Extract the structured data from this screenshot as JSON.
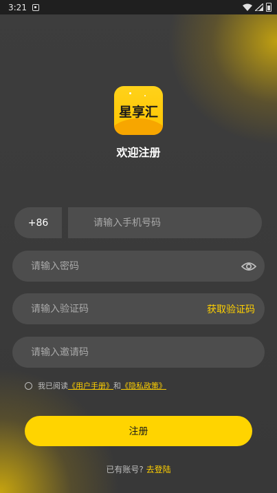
{
  "status_bar": {
    "time": "3:21"
  },
  "app": {
    "logo_text": "星享汇",
    "title": "欢迎注册"
  },
  "form": {
    "country_code": "+86",
    "phone_placeholder": "请输入手机号码",
    "password_placeholder": "请输入密码",
    "code_placeholder": "请输入验证码",
    "get_code_label": "获取验证码",
    "invite_placeholder": "请输入邀请码"
  },
  "agreement": {
    "prefix": "我已阅读",
    "user_manual": "《用户手册》",
    "and": "和",
    "privacy_policy": "《隐私政策》"
  },
  "register_button": "注册",
  "login_prompt": {
    "text": "已有账号?",
    "link": "去登陆"
  },
  "colors": {
    "accent": "#ffd400",
    "field_bg": "#4d4d4d",
    "background": "#3b3b3b"
  }
}
